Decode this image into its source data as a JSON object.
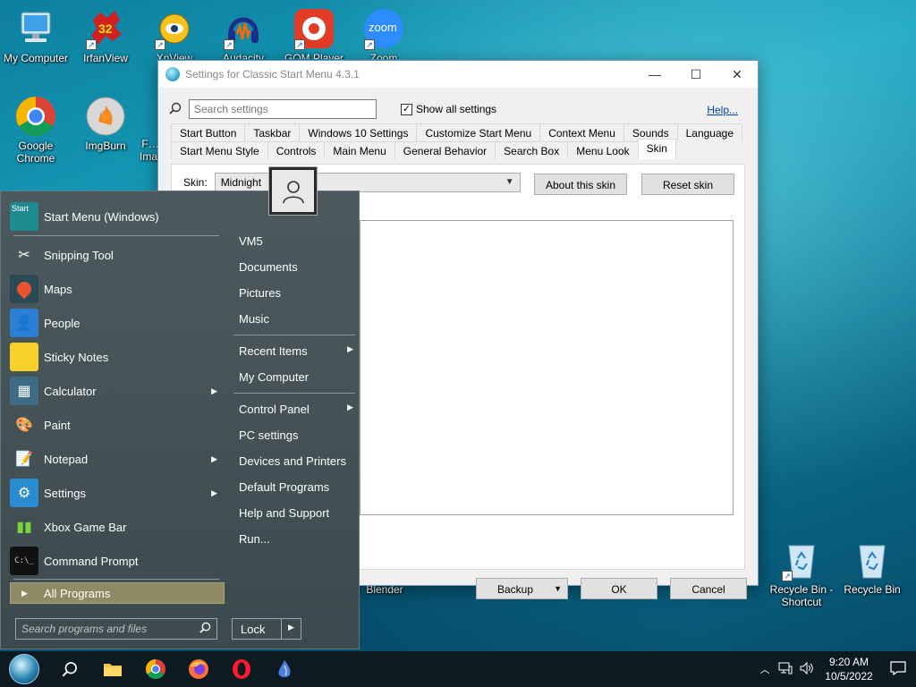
{
  "desktop": {
    "icons": [
      {
        "label": "My Computer"
      },
      {
        "label": "IrfanView"
      },
      {
        "label": "XnView"
      },
      {
        "label": "Audacity"
      },
      {
        "label": "GOM Player"
      },
      {
        "label": "Zoom"
      },
      {
        "label": "Google Chrome"
      },
      {
        "label": "ImgBurn"
      },
      {
        "label": "F… Ima…"
      },
      {
        "label": "Blender"
      },
      {
        "label": "Recycle Bin - Shortcut"
      },
      {
        "label": "Recycle Bin"
      }
    ],
    "irfan_badge": "32",
    "zoom_glyph": "zoom"
  },
  "settings_window": {
    "title": "Settings for Classic Start Menu 4.3.1",
    "min_glyph": "—",
    "max_glyph": "☐",
    "close_glyph": "✕",
    "search_placeholder": "Search settings",
    "show_all_label": "Show all settings",
    "help_label": "Help...",
    "tabs_row1": [
      "Start Button",
      "Taskbar",
      "Windows 10 Settings",
      "Customize Start Menu",
      "Context Menu",
      "Sounds",
      "Language"
    ],
    "tabs_row2": [
      "Start Menu Style",
      "Controls",
      "Main Menu",
      "General Behavior",
      "Search Box",
      "Menu Look",
      "Skin"
    ],
    "active_tab": "Skin",
    "skin_label": "Skin:",
    "skin_value": "Midnight",
    "about_skin_label": "About this skin",
    "reset_skin_label": "Reset skin",
    "backup_label": "Backup",
    "ok_label": "OK",
    "cancel_label": "Cancel"
  },
  "start_menu": {
    "pinned_items": [
      {
        "label": "Start Menu (Windows)",
        "icon": "start-menu-icon",
        "submenu": false
      },
      {
        "label": "Snipping Tool",
        "icon": "snipping-tool-icon",
        "submenu": false
      },
      {
        "label": "Maps",
        "icon": "maps-icon",
        "submenu": false
      },
      {
        "label": "People",
        "icon": "people-icon",
        "submenu": false
      },
      {
        "label": "Sticky Notes",
        "icon": "sticky-notes-icon",
        "submenu": false
      },
      {
        "label": "Calculator",
        "icon": "calculator-icon",
        "submenu": true
      },
      {
        "label": "Paint",
        "icon": "paint-icon",
        "submenu": false
      },
      {
        "label": "Notepad",
        "icon": "notepad-icon",
        "submenu": true
      },
      {
        "label": "Settings",
        "icon": "settings-icon",
        "submenu": true
      },
      {
        "label": "Xbox Game Bar",
        "icon": "xbox-icon",
        "submenu": false
      },
      {
        "label": "Command Prompt",
        "icon": "command-prompt-icon",
        "submenu": false
      }
    ],
    "start_tile_text": "Start",
    "all_programs_label": "All Programs",
    "search_placeholder": "Search programs and files",
    "right_items": [
      {
        "label": "VM5",
        "submenu": false
      },
      {
        "label": "Documents",
        "submenu": false
      },
      {
        "label": "Pictures",
        "submenu": false
      },
      {
        "label": "Music",
        "submenu": false
      },
      {
        "label": "Recent Items",
        "submenu": true
      },
      {
        "label": "My Computer",
        "submenu": false
      },
      {
        "label": "Control Panel",
        "submenu": true
      },
      {
        "label": "PC settings",
        "submenu": false
      },
      {
        "label": "Devices and Printers",
        "submenu": false
      },
      {
        "label": "Default Programs",
        "submenu": false
      },
      {
        "label": "Help and Support",
        "submenu": false
      },
      {
        "label": "Run...",
        "submenu": false
      }
    ],
    "lock_label": "Lock"
  },
  "taskbar": {
    "time": "9:20 AM",
    "date": "10/5/2022"
  }
}
